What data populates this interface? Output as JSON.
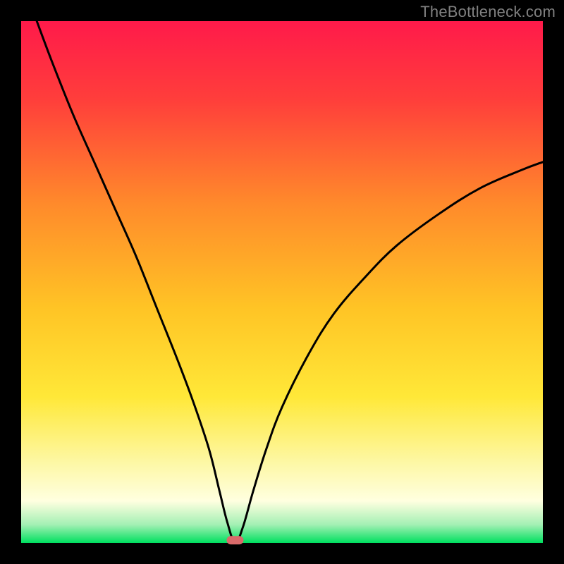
{
  "watermark": "TheBottleneck.com",
  "chart_data": {
    "type": "line",
    "title": "",
    "xlabel": "",
    "ylabel": "",
    "xlim": [
      0,
      100
    ],
    "ylim": [
      0,
      100
    ],
    "grid": false,
    "legend": false,
    "gradient_stops": [
      {
        "offset": 0.0,
        "color": "#ff1a4a"
      },
      {
        "offset": 0.15,
        "color": "#ff3e3b"
      },
      {
        "offset": 0.35,
        "color": "#ff8a2b"
      },
      {
        "offset": 0.55,
        "color": "#ffc425"
      },
      {
        "offset": 0.72,
        "color": "#ffe838"
      },
      {
        "offset": 0.85,
        "color": "#fdf8a8"
      },
      {
        "offset": 0.92,
        "color": "#ffffe0"
      },
      {
        "offset": 0.965,
        "color": "#a4f0b4"
      },
      {
        "offset": 1.0,
        "color": "#00e060"
      }
    ],
    "marker": {
      "x": 41,
      "y": 0.5,
      "color": "#d96a6a"
    },
    "series": [
      {
        "name": "curve",
        "x": [
          3.0,
          6.0,
          10.0,
          14.0,
          18.0,
          22.0,
          26.0,
          30.0,
          33.0,
          36.0,
          38.0,
          39.5,
          41.0,
          42.5,
          44.5,
          47.0,
          50.0,
          55.0,
          60.0,
          66.0,
          72.0,
          80.0,
          88.0,
          96.0,
          100.0
        ],
        "values": [
          100.0,
          92.0,
          82.0,
          73.0,
          64.0,
          55.0,
          45.0,
          35.0,
          27.0,
          18.0,
          10.0,
          4.0,
          0.0,
          3.0,
          10.0,
          18.0,
          26.0,
          36.0,
          44.0,
          51.0,
          57.0,
          63.0,
          68.0,
          71.5,
          73.0
        ]
      }
    ]
  }
}
